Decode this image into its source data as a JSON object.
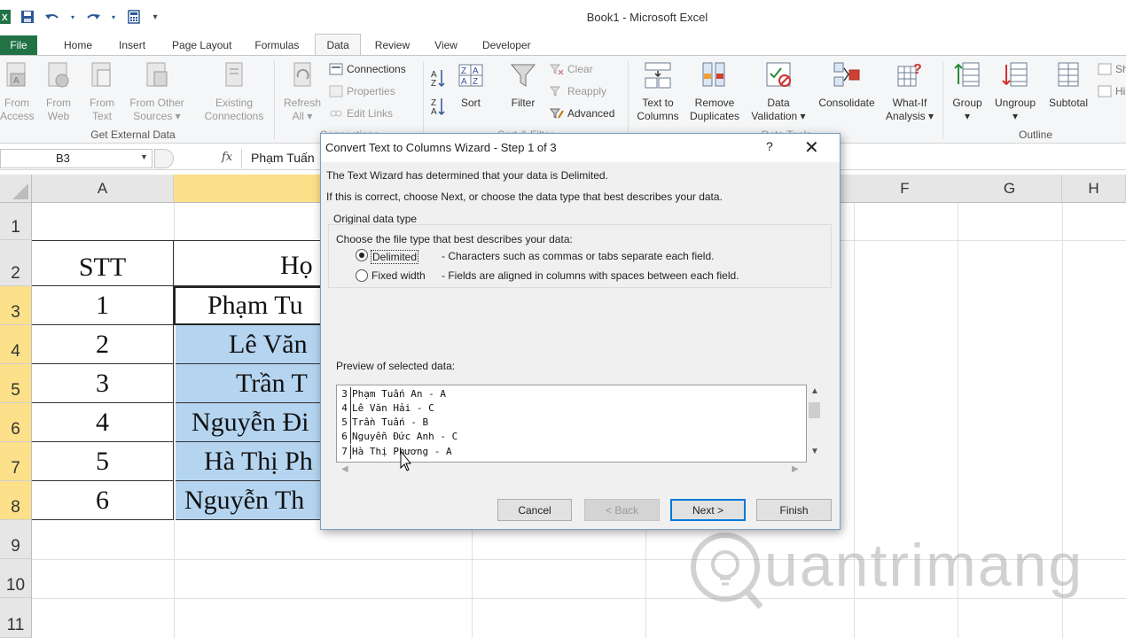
{
  "app": {
    "title": "Book1  -  Microsoft Excel"
  },
  "tabs": [
    {
      "label": "File"
    },
    {
      "label": "Home"
    },
    {
      "label": "Insert"
    },
    {
      "label": "Page Layout"
    },
    {
      "label": "Formulas"
    },
    {
      "label": "Data"
    },
    {
      "label": "Review"
    },
    {
      "label": "View"
    },
    {
      "label": "Developer"
    }
  ],
  "ribbon": {
    "from_access": [
      "From",
      "Access"
    ],
    "from_web": [
      "From",
      "Web"
    ],
    "from_text": [
      "From",
      "Text"
    ],
    "from_other": [
      "From Other",
      "Sources ▾"
    ],
    "existing": [
      "Existing",
      "Connections"
    ],
    "refresh": [
      "Refresh",
      "All ▾"
    ],
    "connections": "Connections",
    "properties": "Properties",
    "edit_links": "Edit Links",
    "sort": "Sort",
    "filter": "Filter",
    "clear": "Clear",
    "reapply": "Reapply",
    "advanced": "Advanced",
    "text_to_columns": [
      "Text to",
      "Columns"
    ],
    "remove_duplicates": [
      "Remove",
      "Duplicates"
    ],
    "data_validation": [
      "Data",
      "Validation ▾"
    ],
    "consolidate": "Consolidate",
    "what_if": [
      "What-If",
      "Analysis ▾"
    ],
    "group": [
      "Group",
      "▾"
    ],
    "ungroup": [
      "Ungroup",
      "▾"
    ],
    "subtotal": "Subtotal",
    "show_detail": "Sh",
    "hide_detail": "Hi",
    "group_get_external": "Get External Data",
    "group_connections": "Connections",
    "group_sort_filter": "Sort & Filter",
    "group_data_tools": "Data Tools",
    "group_outline": "Outline"
  },
  "formula_bar": {
    "name_box": "B3",
    "fx": "fx",
    "content": "Phạm Tuấn"
  },
  "sheet": {
    "columns": [
      "A",
      "F",
      "G",
      "H"
    ],
    "rows": [
      "1",
      "2",
      "3",
      "4",
      "5",
      "6",
      "7",
      "8",
      "9",
      "10",
      "11"
    ],
    "cells": {
      "A2": "STT",
      "B2": "Họ",
      "A3": "1",
      "B3": "Phạm Tu",
      "A4": "2",
      "B4": "Lê Văn",
      "A5": "3",
      "B5": "Trần T",
      "A6": "4",
      "B6": "Nguyễn Đi",
      "A7": "5",
      "B7": "Hà Thị Ph",
      "A8": "6",
      "B8": "Nguyễn Th"
    }
  },
  "dialog": {
    "title": "Convert Text to Columns Wizard - Step 1 of 3",
    "help": "?",
    "close": "✕",
    "intro1": "The Text Wizard has determined that your data is Delimited.",
    "intro2": "If this is correct, choose Next, or choose the data type that best describes your data.",
    "original_type_label": "Original data type",
    "choose_label": "Choose the file type that best describes your data:",
    "options": [
      {
        "label": "Delimited",
        "desc": "- Characters such as commas or tabs separate each field.",
        "selected": true
      },
      {
        "label": "Fixed width",
        "desc": "- Fields are aligned in columns with spaces between each field.",
        "selected": false
      }
    ],
    "preview_label": "Preview of selected data:",
    "preview_rows": [
      {
        "num": "3",
        "text": "Phạm Tuấn An - A"
      },
      {
        "num": "4",
        "text": "Lê Văn Hải - C"
      },
      {
        "num": "5",
        "text": "Trần Tuấn - B"
      },
      {
        "num": "6",
        "text": "Nguyễn Đức Anh - C"
      },
      {
        "num": "7",
        "text": "Hà Thị Phương - A"
      }
    ],
    "buttons": {
      "cancel": "Cancel",
      "back": "< Back",
      "next": "Next >",
      "finish": "Finish"
    }
  },
  "watermark": {
    "text": "uantrimang"
  },
  "colors": {
    "excel_green": "#217346",
    "selected_header": "#fde08a",
    "selected_cells": "#b4d4f0"
  }
}
